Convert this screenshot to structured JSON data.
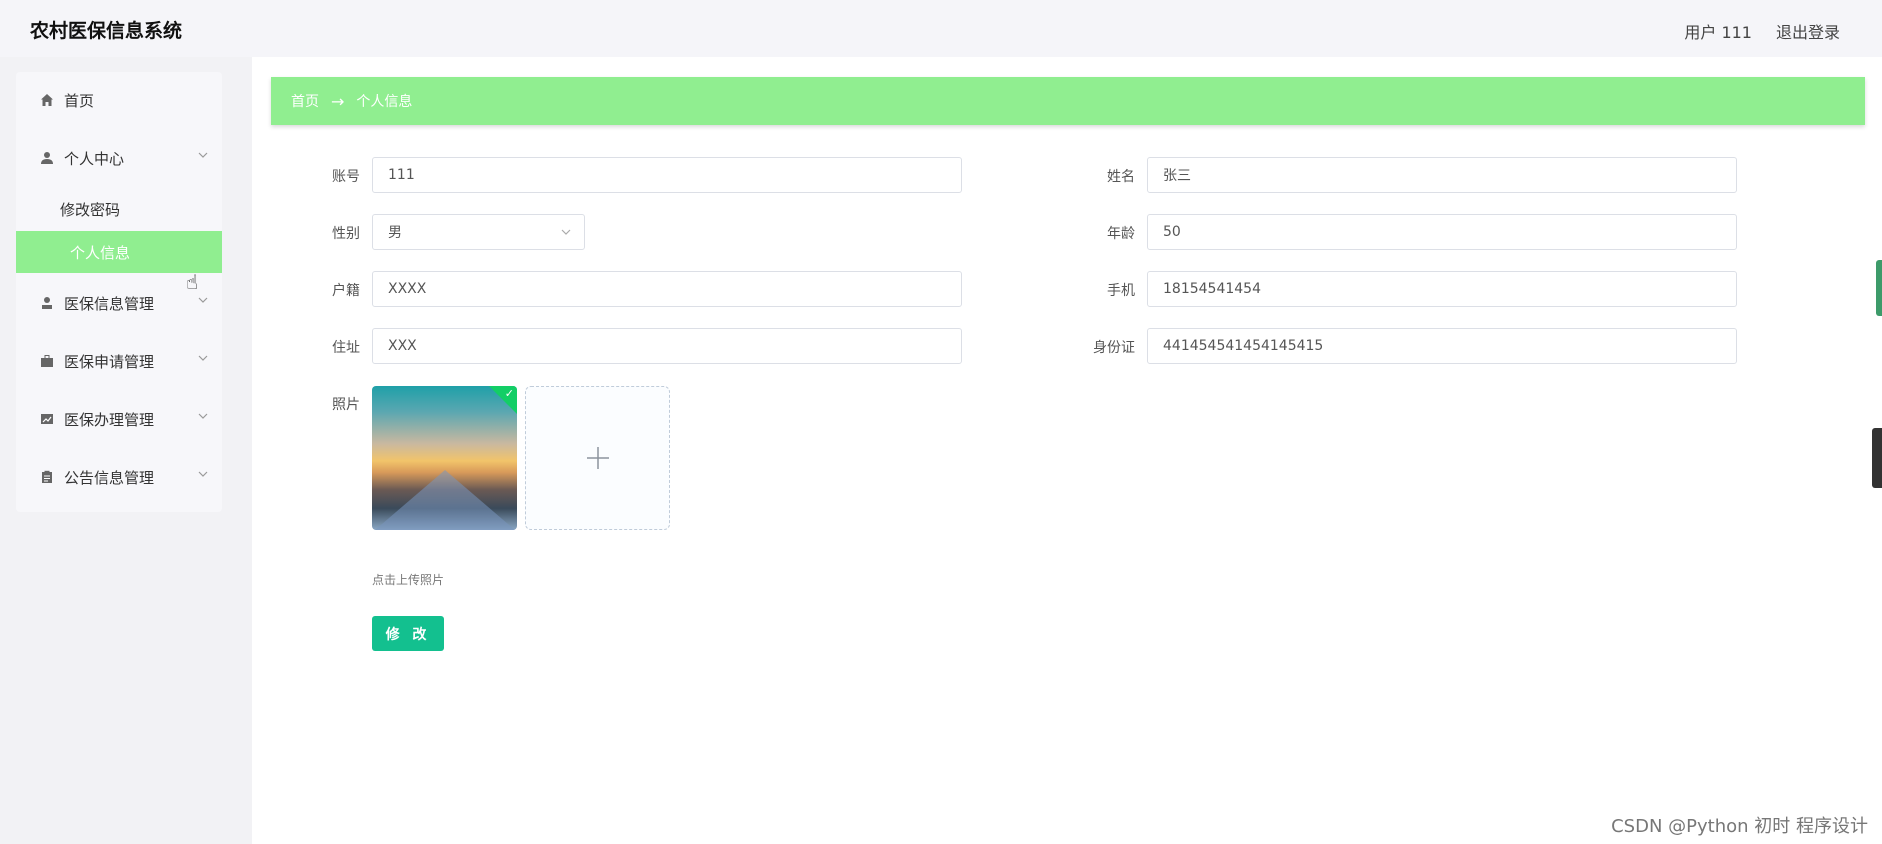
{
  "header": {
    "title": "农村医保信息系统",
    "user": "用户 111",
    "logout": "退出登录"
  },
  "sidebar": {
    "home": "首页",
    "personal_center": "个人中心",
    "change_password": "修改密码",
    "personal_info": "个人信息",
    "insurance_info": "医保信息管理",
    "insurance_apply": "医保申请管理",
    "insurance_process": "医保办理管理",
    "notice": "公告信息管理"
  },
  "breadcrumb": {
    "home": "首页",
    "arrow": "→",
    "current": "个人信息"
  },
  "form": {
    "account_label": "账号",
    "account_value": "111",
    "name_label": "姓名",
    "name_value": "张三",
    "gender_label": "性别",
    "gender_value": "男",
    "age_label": "年龄",
    "age_value": "50",
    "hukou_label": "户籍",
    "hukou_value": "XXXX",
    "phone_label": "手机",
    "phone_value": "18154541454",
    "address_label": "住址",
    "address_value": "XXX",
    "idcard_label": "身份证",
    "idcard_value": "441454541454145415",
    "photo_label": "照片",
    "upload_tip": "点击上传照片",
    "submit": "修 改"
  },
  "watermark": "CSDN @Python 初时 程序设计",
  "colors": {
    "accent": "#90ee90",
    "button": "#13c08f",
    "success": "#13ce66"
  }
}
